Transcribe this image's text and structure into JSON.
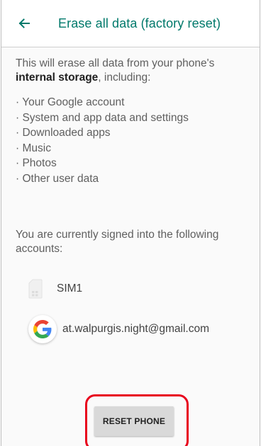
{
  "appbar": {
    "back_icon": "arrow-back-icon",
    "title": "Erase all data (factory reset)"
  },
  "intro": {
    "text_before": "This will erase all data from your phone's ",
    "bold": "internal storage",
    "text_after": ", including:"
  },
  "items": [
    "Your Google account",
    "System and app data and settings",
    "Downloaded apps",
    "Music",
    "Photos",
    "Other user data"
  ],
  "signed_in_text": "You are currently signed into the following accounts:",
  "accounts": [
    {
      "icon": "sim-card-icon",
      "label": "SIM1"
    },
    {
      "icon": "google-icon",
      "label": "at.walpurgis.night@gmail.com"
    }
  ],
  "reset_button": {
    "label": "RESET PHONE"
  },
  "colors": {
    "accent": "#00796b",
    "highlight": "#e8001c",
    "button_bg": "#d9d9d9"
  }
}
